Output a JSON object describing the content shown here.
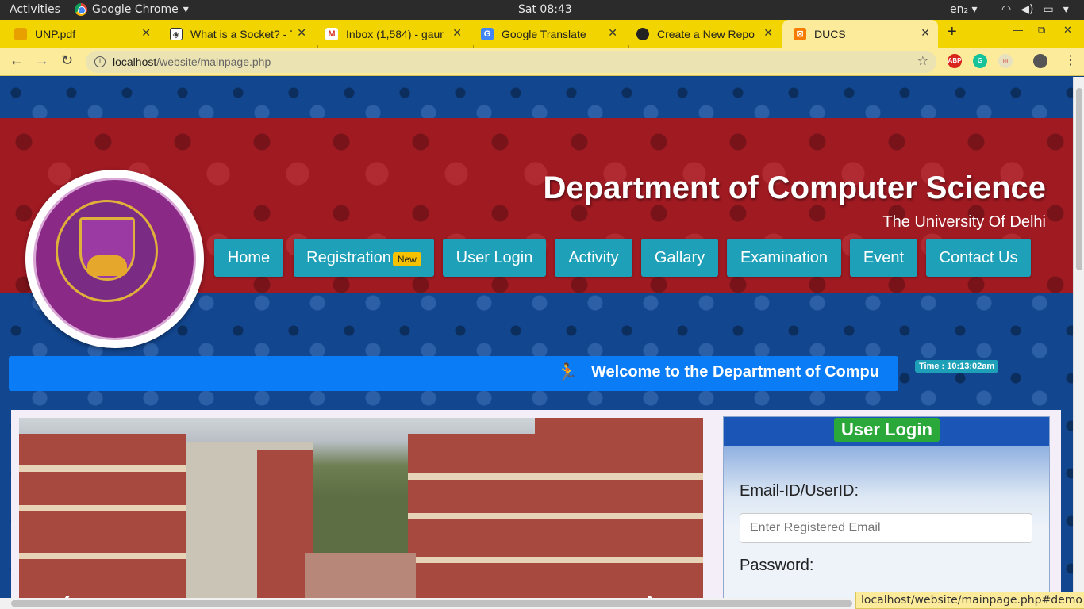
{
  "os": {
    "activities": "Activities",
    "app": "Google Chrome",
    "clock": "Sat 08:43",
    "lang": "en₂"
  },
  "tabs": [
    {
      "title": "UNP.pdf",
      "icon": "pdf-icon"
    },
    {
      "title": "What is a Socket? - T",
      "icon": "doc-icon"
    },
    {
      "title": "Inbox (1,584) - gaur",
      "icon": "gmail-icon"
    },
    {
      "title": "Google Translate",
      "icon": "translate-icon"
    },
    {
      "title": "Create a New Repo",
      "icon": "github-icon"
    },
    {
      "title": "DUCS",
      "icon": "xampp-icon"
    }
  ],
  "address": {
    "host": "localhost",
    "path": "/website/mainpage.php"
  },
  "header": {
    "title": "Department of Computer Science",
    "subtitle": "The University Of Delhi"
  },
  "nav": {
    "home": "Home",
    "registration": "Registration",
    "new_badge": "New",
    "user_login": "User Login",
    "activity": "Activity",
    "gallary": "Gallary",
    "examination": "Examination",
    "event": "Event",
    "contact": "Contact Us"
  },
  "marquee": {
    "text": "Welcome to the Department of Compu"
  },
  "time": {
    "text": "Time : 10:13:02am"
  },
  "login": {
    "heading": "User Login",
    "email_label": "Email-ID/UserID:",
    "email_placeholder": "Enter Registered Email",
    "password_label": "Password:"
  },
  "status_url": "localhost/website/mainpage.php#demo"
}
